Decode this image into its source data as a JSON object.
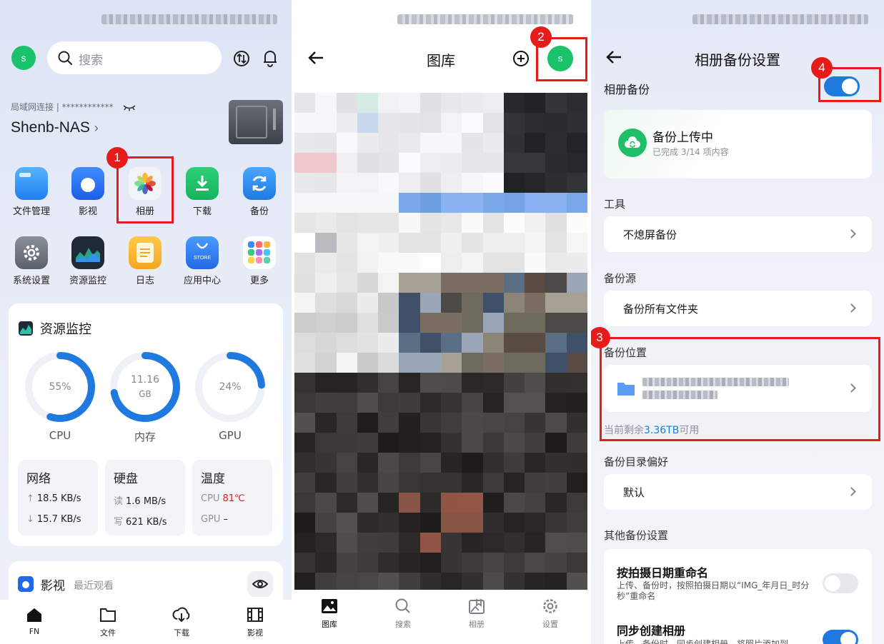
{
  "colors": {
    "accent": "#1f7ae0",
    "annotation_red": "#e81b1b",
    "avatar_green": "#19c36a"
  },
  "home": {
    "avatar_letter": "s",
    "search_placeholder": "搜索",
    "lan_status": "局域网连接 | ************",
    "device_name": "Shenb-NAS",
    "apps": [
      {
        "label": "文件管理",
        "icon": "folder-icon"
      },
      {
        "label": "影视",
        "icon": "video-icon"
      },
      {
        "label": "相册",
        "icon": "photos-icon"
      },
      {
        "label": "下载",
        "icon": "download-icon"
      },
      {
        "label": "备份",
        "icon": "backup-icon"
      },
      {
        "label": "系统设置",
        "icon": "settings-icon"
      },
      {
        "label": "资源监控",
        "icon": "monitor-icon"
      },
      {
        "label": "日志",
        "icon": "log-icon"
      },
      {
        "label": "应用中心",
        "icon": "store-icon"
      },
      {
        "label": "更多",
        "icon": "more-icon"
      }
    ],
    "store_badge": "STORE",
    "monitor": {
      "title": "资源监控",
      "cpu": {
        "label": "CPU",
        "value": "55%",
        "fraction": 0.55
      },
      "mem": {
        "label": "内存",
        "value_line1": "11.16",
        "value_line2": "GB",
        "fraction": 0.72
      },
      "gpu": {
        "label": "GPU",
        "value": "24%",
        "fraction": 0.24
      },
      "network": {
        "title": "网络",
        "up": "18.5 KB/s",
        "down": "15.7 KB/s"
      },
      "disk": {
        "title": "硬盘",
        "read_key": "读",
        "read": "1.6 MB/s",
        "write_key": "写",
        "write": "621 KB/s"
      },
      "temp": {
        "title": "温度",
        "cpu_key": "CPU",
        "cpu": "81℃",
        "gpu_key": "GPU",
        "gpu": "–"
      }
    },
    "video_card": {
      "title": "影视",
      "subtitle": "最近观看"
    },
    "tabs": [
      "FN",
      "文件",
      "下载",
      "影视"
    ]
  },
  "gallery": {
    "title": "图库",
    "avatar_letter": "s",
    "tabs": [
      "图库",
      "搜索",
      "相册",
      "设置"
    ]
  },
  "backup_settings": {
    "title": "相册备份设置",
    "album_backup_label": "相册备份",
    "album_backup_on": true,
    "status_title": "备份上传中",
    "status_sub": "已完成 3/14 项内容",
    "tools_section": "工具",
    "tools_item": "不熄屏备份",
    "source_section": "备份源",
    "source_item": "备份所有文件夹",
    "location_section": "备份位置",
    "remaining_prefix": "当前剩余",
    "remaining_value": "3.36TB",
    "remaining_suffix": "可用",
    "pref_section": "备份目录偏好",
    "pref_item": "默认",
    "other_section": "其他备份设置",
    "rename_title": "按拍摄日期重命名",
    "rename_desc": "上传、备份时，按照拍摄日期以“IMG_年月日_时分秒”重命名",
    "rename_on": false,
    "sync_title": "同步创建相册",
    "sync_desc": "上传、备份时，同步创建相册，将照片添加到",
    "sync_on": true
  },
  "annotations": [
    "1",
    "2",
    "3",
    "4"
  ]
}
